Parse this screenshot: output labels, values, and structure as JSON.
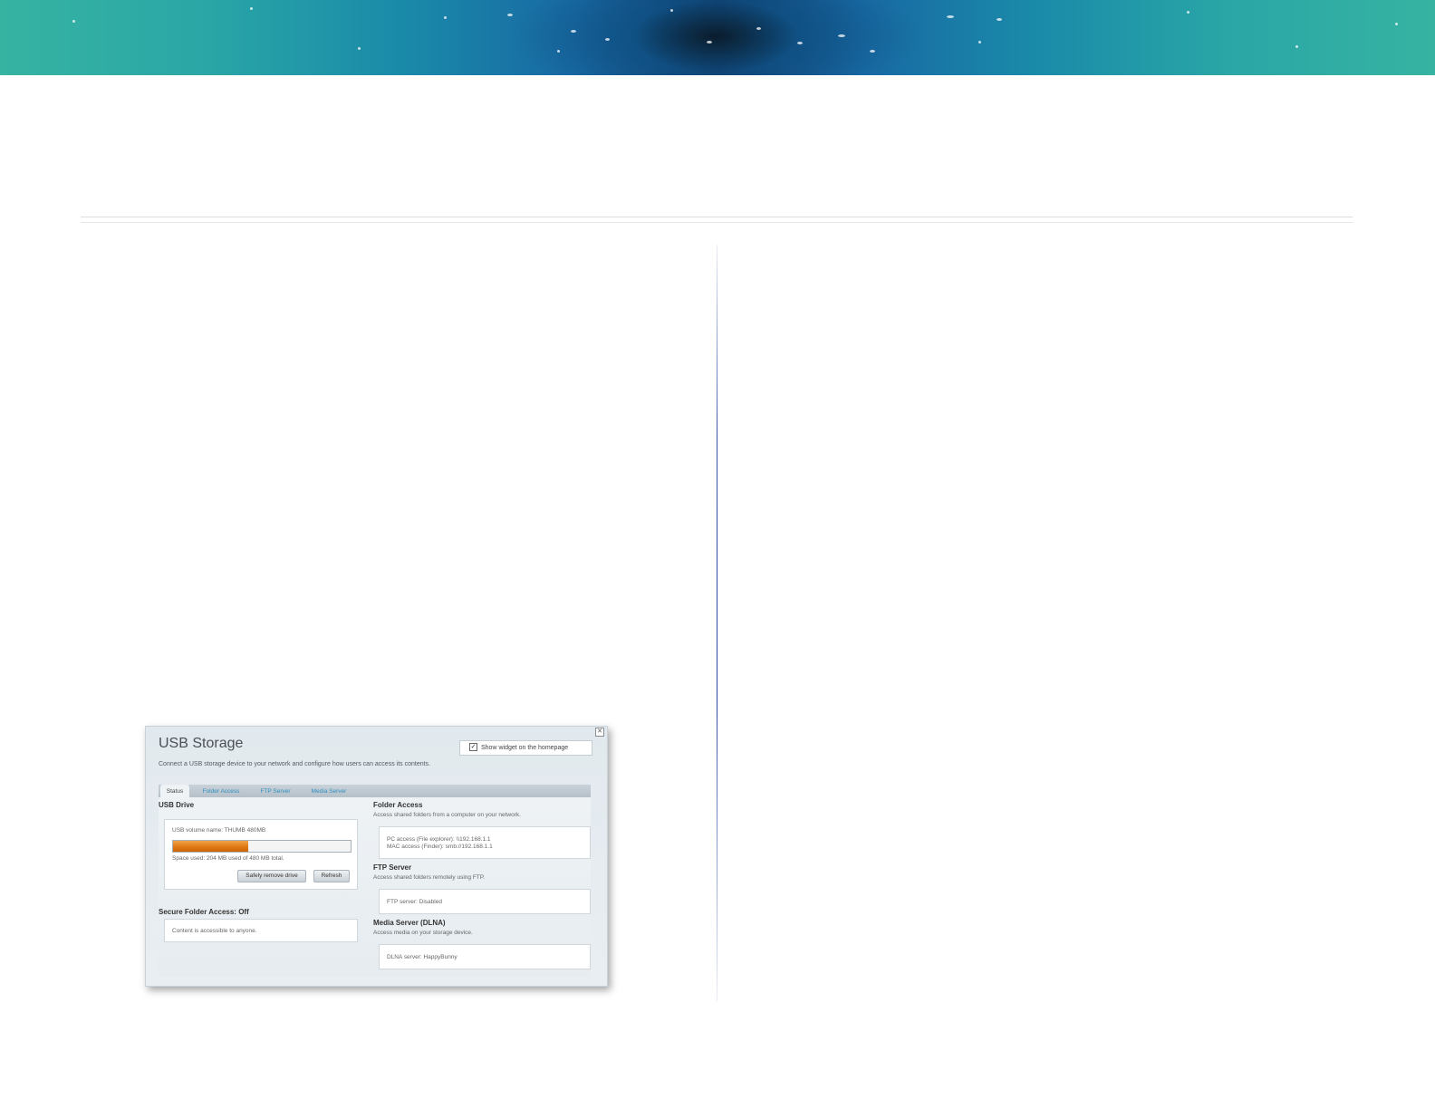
{
  "figure": {
    "title": "USB Storage",
    "description": "Connect a USB storage device to your network and configure how users can access its contents.",
    "close_label": "✕",
    "show_widget_label": "Show widget on the homepage",
    "show_widget_checked": true,
    "tabs": [
      {
        "label": "Status",
        "active": true
      },
      {
        "label": "Folder Access",
        "active": false
      },
      {
        "label": "FTP Server",
        "active": false
      },
      {
        "label": "Media Server",
        "active": false
      }
    ],
    "usb_drive": {
      "heading": "USB Drive",
      "volume_name": "USB volume name: THUMB 480MB",
      "space_used_fraction": 0.425,
      "space_used": "Space used: 204 MB used of 480 MB total.",
      "safely_remove_label": "Safely remove drive",
      "refresh_label": "Refresh"
    },
    "secure_folder": {
      "heading": "Secure Folder Access: Off",
      "text": "Content is accessible to anyone."
    },
    "folder_access": {
      "heading": "Folder Access",
      "sub": "Access shared folders from a computer on your network.",
      "pc_access": "PC access (File explorer): \\\\192.168.1.1",
      "mac_access": "MAC access (Finder): smb://192.168.1.1"
    },
    "ftp_server": {
      "heading": "FTP Server",
      "sub": "Access shared folders remotely using FTP.",
      "status": "FTP server: Disabled"
    },
    "media_server": {
      "heading": "Media Server (DLNA)",
      "sub": "Access media on your storage device.",
      "status": "DLNA server: HappyBunny"
    }
  }
}
